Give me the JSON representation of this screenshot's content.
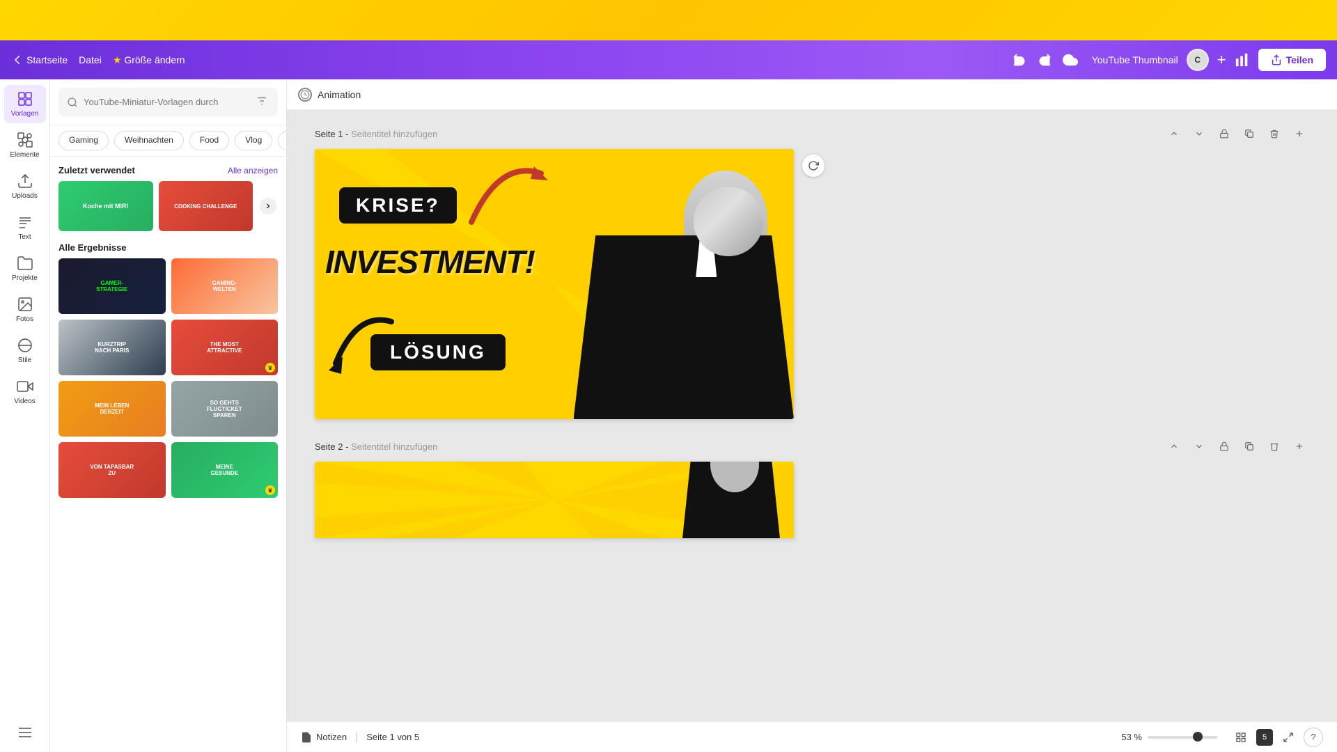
{
  "header": {
    "back_label": "Startseite",
    "datei_label": "Datei",
    "grosse_label": "Größe ändern",
    "title": "YouTube Thumbnail",
    "teilen_label": "Teilen",
    "avatar_initials": "C"
  },
  "sidebar": {
    "items": [
      {
        "id": "vorlagen",
        "label": "Vorlagen",
        "active": true
      },
      {
        "id": "elemente",
        "label": "Elemente",
        "active": false
      },
      {
        "id": "uploads",
        "label": "Uploads",
        "active": false
      },
      {
        "id": "text",
        "label": "Text",
        "active": false
      },
      {
        "id": "projekte",
        "label": "Projekte",
        "active": false
      },
      {
        "id": "fotos",
        "label": "Fotos",
        "active": false
      },
      {
        "id": "stile",
        "label": "Stile",
        "active": false
      },
      {
        "id": "videos",
        "label": "Videos",
        "active": false
      }
    ]
  },
  "left_panel": {
    "search_placeholder": "YouTube-Miniatur-Vorlagen durch",
    "categories": [
      "Gaming",
      "Weihnachten",
      "Food",
      "Vlog"
    ],
    "recently_used_label": "Zuletzt verwendet",
    "show_all_label": "Alle anzeigen",
    "all_results_label": "Alle Ergebnisse",
    "recent_items": [
      {
        "label": "Koche mit MIR!",
        "color1": "#2ecc71",
        "color2": "#27ae60"
      },
      {
        "label": "COOKING CHALLENGE",
        "color1": "#e74c3c",
        "color2": "#c0392b"
      }
    ],
    "result_items": [
      {
        "label": "GAMER-STRATEGIE",
        "color1": "#1a1a2e",
        "color2": "#16213e",
        "crown": false
      },
      {
        "label": "GAMING-WELTEN",
        "color1": "#ff6b35",
        "color2": "#f39c12",
        "crown": false
      },
      {
        "label": "KURZTRIP NACH PARIS",
        "color1": "#bdc3c7",
        "color2": "#2c3e50",
        "crown": false
      },
      {
        "label": "THE MOST ATTRACTIVE THUMBNAIL",
        "color1": "#e74c3c",
        "color2": "#c0392b",
        "crown": true
      },
      {
        "label": "MEIN LEBEN DERZEIT",
        "color1": "#f39c12",
        "color2": "#e67e22",
        "crown": false
      },
      {
        "label": "SO GEHTS AN FLUGTICKET-KOSTEN SPAREN",
        "color1": "#95a5a6",
        "color2": "#7f8c8d",
        "crown": false
      },
      {
        "label": "VON TAPASBAR ZU",
        "color1": "#e74c3c",
        "color2": "#c0392b",
        "crown": false
      },
      {
        "label": "MEINE GESUNDE",
        "color1": "#27ae60",
        "color2": "#2ecc71",
        "crown": true
      }
    ]
  },
  "canvas": {
    "animation_label": "Animation",
    "page1": {
      "label": "Seite 1",
      "title_placeholder": "Seitentitel hinzufügen",
      "content": {
        "krise": "KRISE?",
        "investment": "INVESTMENT!",
        "loesung": "LÖSUNG"
      }
    },
    "page2": {
      "label": "Seite 2",
      "title_placeholder": "Seitentitel hinzufügen"
    }
  },
  "status_bar": {
    "notizen_label": "Notizen",
    "page_info": "Seite 1 von 5",
    "zoom_percent": "53 %",
    "grid_count": "5"
  }
}
